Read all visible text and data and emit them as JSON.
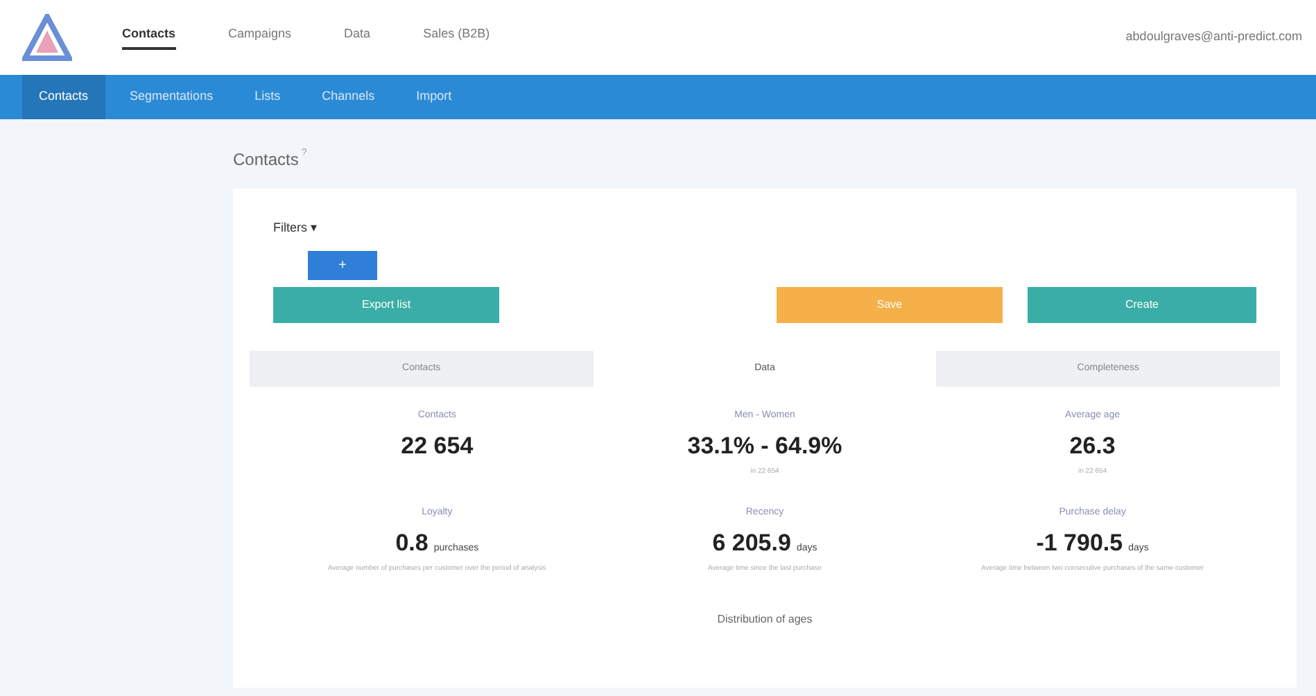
{
  "top_nav": [
    {
      "label": "Contacts",
      "selected": true
    },
    {
      "label": "Campaigns",
      "selected": false
    },
    {
      "label": "Data",
      "selected": false
    },
    {
      "label": "Sales (B2B)",
      "selected": false
    }
  ],
  "user_email": "abdoulgraves@anti-predict.com",
  "sub_nav": [
    {
      "label": "Contacts",
      "selected": true
    },
    {
      "label": "Segmentations",
      "selected": false
    },
    {
      "label": "Lists",
      "selected": false
    },
    {
      "label": "Channels",
      "selected": false
    },
    {
      "label": "Import",
      "selected": false
    }
  ],
  "page_title": "Contacts",
  "help_mark": "?",
  "filters_label": "Filters ▾",
  "add_button": "+",
  "buttons": [
    {
      "label": "Export list",
      "color": "#3aaea6"
    },
    {
      "label": "Save",
      "color": "#f5b04a"
    },
    {
      "label": "Create",
      "color": "#3aaea6"
    }
  ],
  "tabs": [
    {
      "label": "Contacts",
      "selected": false
    },
    {
      "label": "Data",
      "selected": true
    },
    {
      "label": "Completeness",
      "selected": false
    }
  ],
  "stats": [
    {
      "title": "Contacts",
      "value": "22 654"
    },
    {
      "title": "Men - Women",
      "value": "33.1% - 64.9%",
      "note": "in 22 654"
    },
    {
      "title": "Average age",
      "value": "26.3",
      "note": "in 22 654"
    },
    {
      "title": "Loyalty",
      "value": "0.8",
      "unit": "purchases",
      "note": "Average number of purchases per customer over the period of analysis"
    },
    {
      "title": "Recency",
      "value": "6 205.9",
      "unit": "days",
      "note": "Average time since the last purchase"
    },
    {
      "title": "Purchase delay",
      "value": "-1 790.5",
      "unit": "days",
      "note": "Average time between two consecutive purchases of the same customer"
    }
  ],
  "section_title": "Distribution of ages"
}
